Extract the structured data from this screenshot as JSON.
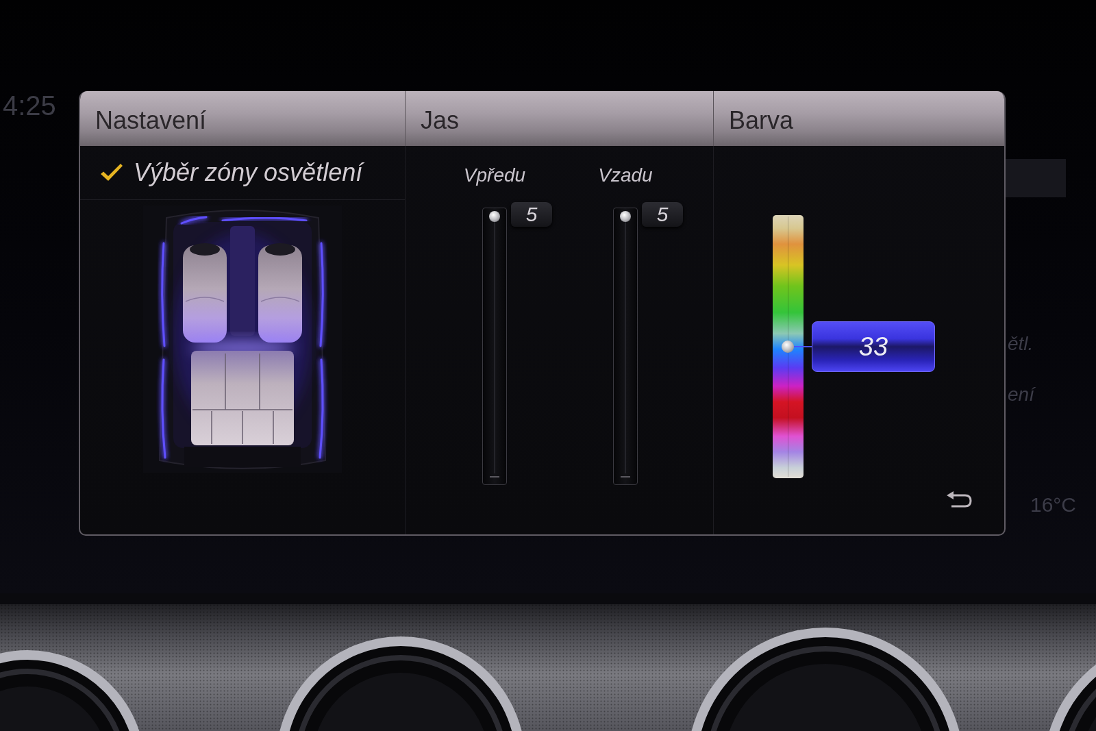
{
  "background": {
    "clock": "4:25",
    "menu_fragments": [
      "ětl.",
      "ení"
    ],
    "temperature": "16°C"
  },
  "panel": {
    "settings": {
      "title": "Nastavení",
      "zone_selection": {
        "label": "Výběr zóny osvětlení",
        "checked": true
      }
    },
    "brightness": {
      "title": "Jas",
      "sliders": [
        {
          "label": "Vpředu",
          "value": "5",
          "level": 1
        },
        {
          "label": "Vzadu",
          "value": "5",
          "level": 1
        }
      ]
    },
    "color": {
      "title": "Barva",
      "value": "33",
      "level": 0.5
    }
  }
}
